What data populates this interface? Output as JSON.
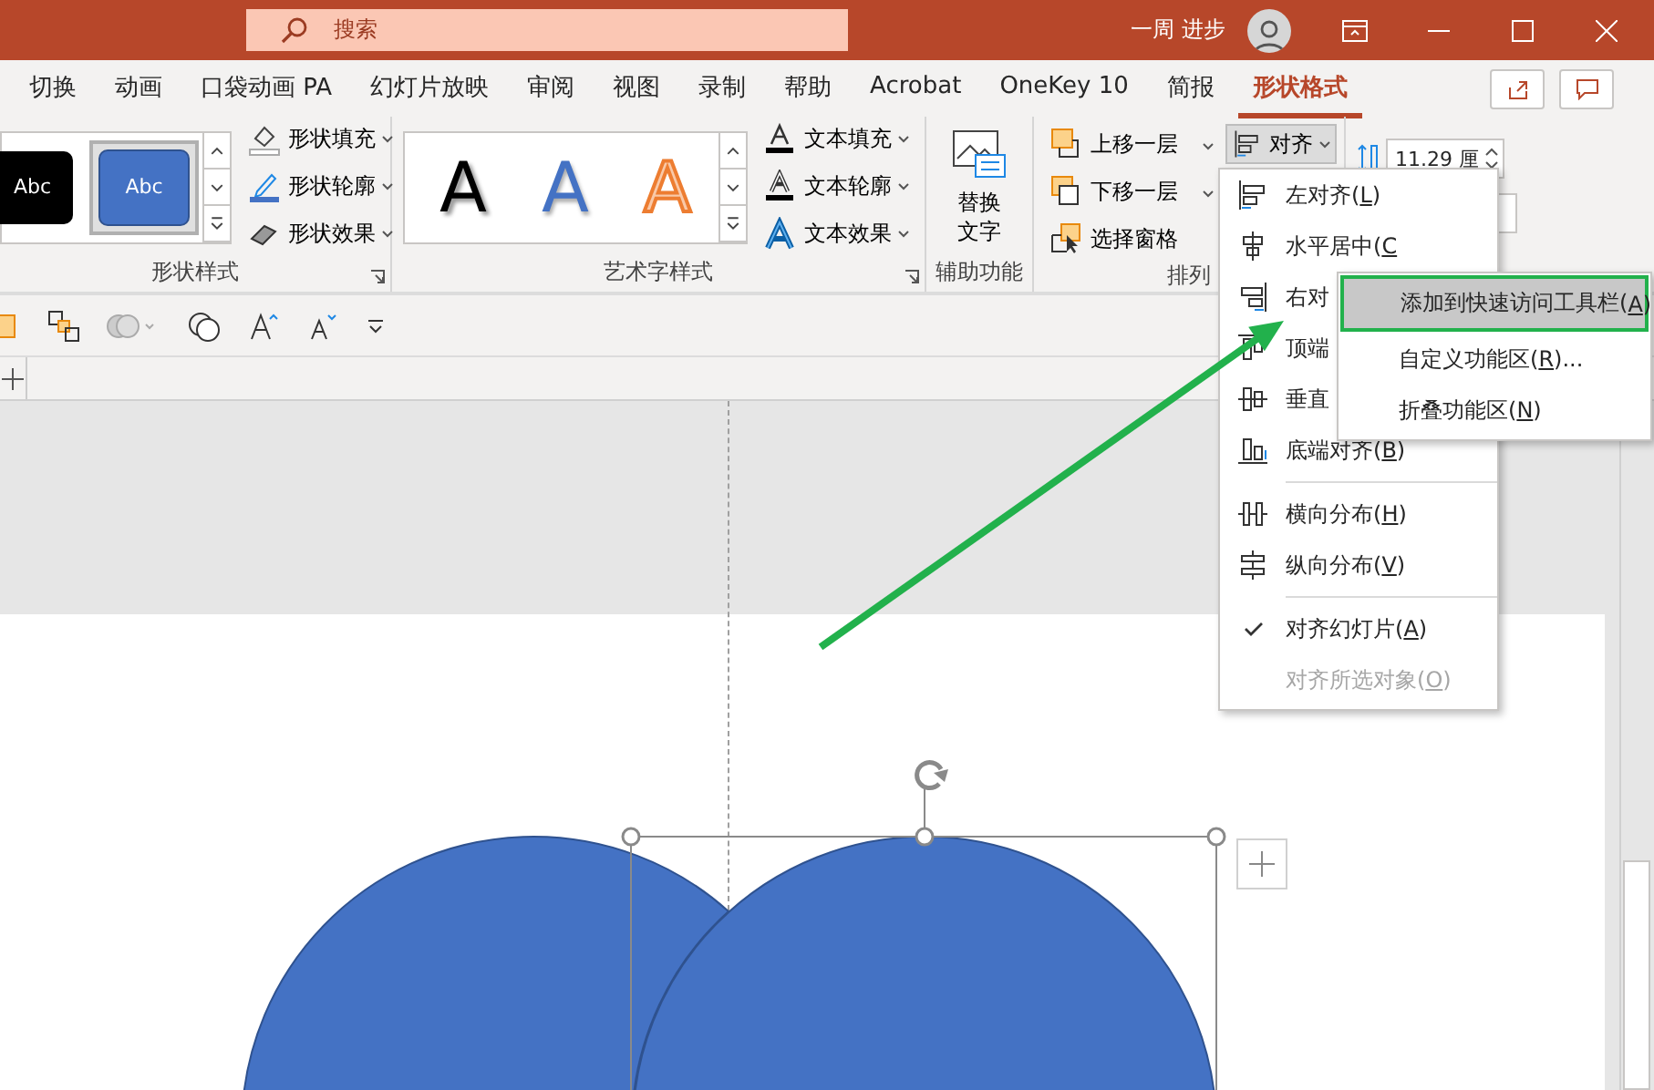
{
  "title_bar": {
    "search_placeholder": "搜索",
    "user_name": "一周 进步"
  },
  "tabs": [
    {
      "label": "切换",
      "selected": false
    },
    {
      "label": "动画",
      "selected": false
    },
    {
      "label": "口袋动画 PA",
      "selected": false
    },
    {
      "label": "幻灯片放映",
      "selected": false
    },
    {
      "label": "审阅",
      "selected": false
    },
    {
      "label": "视图",
      "selected": false
    },
    {
      "label": "录制",
      "selected": false
    },
    {
      "label": "帮助",
      "selected": false
    },
    {
      "label": "Acrobat",
      "selected": false
    },
    {
      "label": "OneKey 10",
      "selected": false
    },
    {
      "label": "简报",
      "selected": false
    },
    {
      "label": "形状格式",
      "selected": true
    }
  ],
  "ribbon": {
    "shape_styles": {
      "label": "形状样式",
      "styles": [
        {
          "text": "Abc",
          "selected": false
        },
        {
          "text": "Abc",
          "selected": true
        }
      ],
      "commands": [
        "形状填充",
        "形状轮廓",
        "形状效果"
      ]
    },
    "wordart_styles": {
      "label": "艺术字样式",
      "styles": [
        "A",
        "A",
        "A"
      ],
      "commands": [
        "文本填充",
        "文本轮廓",
        "文本效果"
      ]
    },
    "accessibility": {
      "label": "辅助功能",
      "button": "替换文字"
    },
    "arrange": {
      "label": "排列",
      "commands": [
        "上移一层",
        "下移一层",
        "选择窗格"
      ],
      "align_button": "对齐"
    },
    "size": {
      "height": "11.29 厘"
    }
  },
  "align_menu": [
    {
      "kind": "item",
      "text": "左对齐(",
      "key": "L",
      "tail": ")",
      "checked": false,
      "disabled": false
    },
    {
      "kind": "item",
      "text": "水平居中(",
      "key": "C",
      "checked": false,
      "disabled": false
    },
    {
      "kind": "item",
      "text": "右对",
      "checked": false,
      "disabled": false
    },
    {
      "kind": "item",
      "text": "顶端",
      "checked": false,
      "disabled": false
    },
    {
      "kind": "item",
      "text": "垂直",
      "checked": false,
      "disabled": false
    },
    {
      "kind": "item",
      "text": "底端对齐(",
      "key": "B",
      "tail": ")",
      "checked": false,
      "disabled": false
    },
    {
      "kind": "separator"
    },
    {
      "kind": "item",
      "text": "横向分布(",
      "key": "H",
      "tail": ")",
      "checked": false,
      "disabled": false
    },
    {
      "kind": "item",
      "text": "纵向分布(",
      "key": "V",
      "tail": ")",
      "checked": false,
      "disabled": false
    },
    {
      "kind": "separator"
    },
    {
      "kind": "item",
      "text": "对齐幻灯片(",
      "key": "A",
      "tail": ")",
      "checked": true,
      "disabled": false
    },
    {
      "kind": "item",
      "text": "对齐所选对象(",
      "key": "O",
      "tail": ")",
      "checked": false,
      "disabled": true
    }
  ],
  "context_menu": [
    {
      "text": "添加到快速访问工具栏(",
      "key": "A",
      "tail": ")",
      "selected": true
    },
    {
      "text": "自定义功能区(",
      "key": "R",
      "tail": ")...",
      "selected": false
    },
    {
      "text": "折叠功能区(",
      "key": "N",
      "tail": ")",
      "selected": false
    }
  ]
}
